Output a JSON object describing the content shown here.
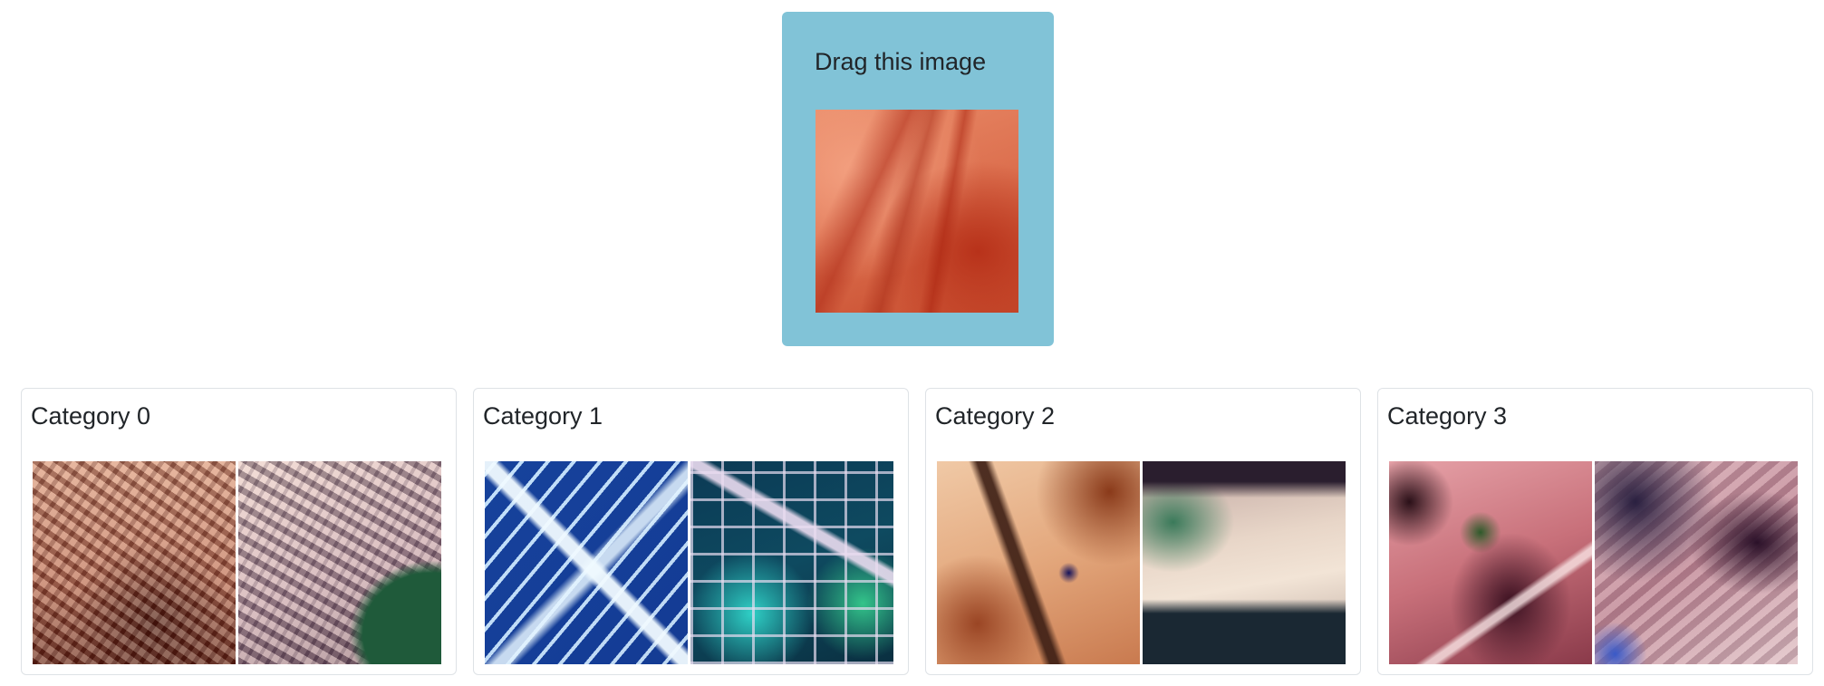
{
  "drag_card": {
    "title": "Drag this image",
    "background_color": "#81c3d7"
  },
  "categories": [
    {
      "label": "Category 0"
    },
    {
      "label": "Category 1"
    },
    {
      "label": "Category 2"
    },
    {
      "label": "Category 3"
    }
  ]
}
